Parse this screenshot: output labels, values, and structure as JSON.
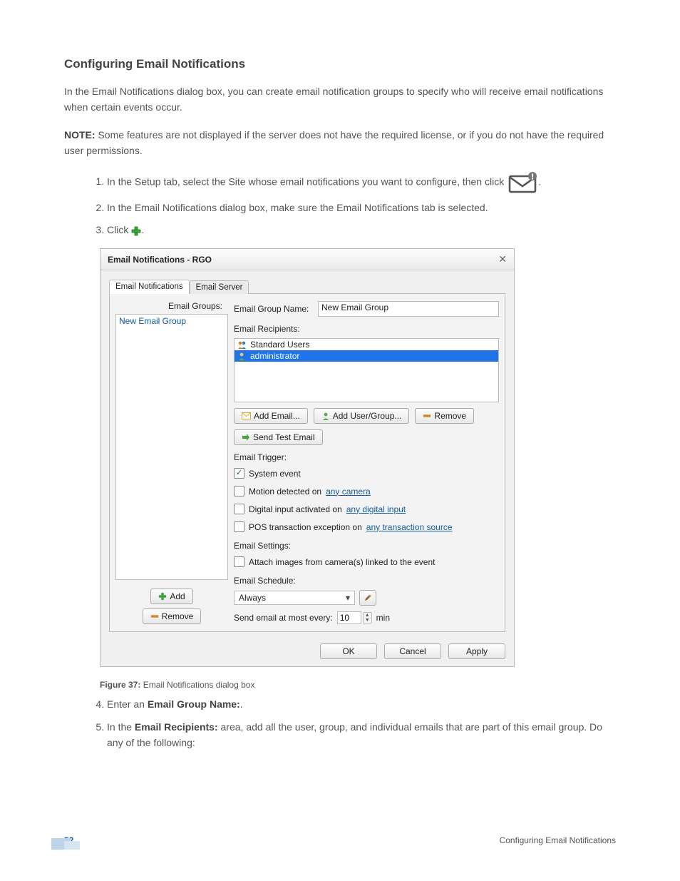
{
  "doc": {
    "section_title": "Configuring Email Notifications",
    "para1": "In the Email Notifications dialog box, you can create email notification groups to specify who will receive email notifications when certain events occur.",
    "note_label": "NOTE:",
    "note_text": " Some features are not displayed if the server does not have the required license, or if you do not have the required user permissions.",
    "step1": "In the Setup tab, select the Site whose email notifications you want to configure, then click ",
    "step1_tail": ".",
    "step2": "In the Email Notifications dialog box, make sure the Email Notifications tab is selected.",
    "step3_pre": "Click ",
    "step3_post": ".",
    "figure_label": "Figure 37:",
    "figure_text": " Email Notifications dialog box",
    "step4_pre": "Enter an ",
    "step4_bold": "Email Group Name:",
    "step4_post": ".",
    "step5_pre": "In the ",
    "step5_bold": "Email Recipients:",
    "step5_post": " area, add all the user, group, and individual emails that are part of this email group. Do any of the following:"
  },
  "footer": {
    "page_number": "52",
    "section": "Configuring Email Notifications"
  },
  "dialog": {
    "title": "Email Notifications - RGO",
    "tabs": {
      "notifications": "Email Notifications",
      "server": "Email Server"
    },
    "left": {
      "label": "Email Groups:",
      "selected": "New Email Group",
      "add_btn": "Add",
      "remove_btn": "Remove"
    },
    "right": {
      "group_name_label": "Email Group Name:",
      "group_name_value": "New Email Group",
      "recipients_label": "Email Recipients:",
      "recipients": {
        "r0": "Standard Users",
        "r1": "administrator"
      },
      "add_email_btn": "Add Email...",
      "add_user_btn": "Add User/Group...",
      "remove_btn": "Remove",
      "send_test_btn": "Send Test Email",
      "trigger_label": "Email Trigger:",
      "t_system": "System event",
      "t_motion_pre": "Motion detected on ",
      "t_motion_link": "any camera",
      "t_digital_pre": "Digital input activated on ",
      "t_digital_link": "any digital input",
      "t_pos_pre": "POS transaction exception on ",
      "t_pos_link": "any transaction source",
      "settings_label": "Email Settings:",
      "settings_chk": "Attach images from camera(s) linked to the event",
      "schedule_label": "Email Schedule:",
      "schedule_value": "Always",
      "freq_label": "Send email at most every:",
      "freq_value": "10",
      "freq_unit": "min"
    },
    "footer": {
      "ok": "OK",
      "cancel": "Cancel",
      "apply": "Apply"
    }
  }
}
